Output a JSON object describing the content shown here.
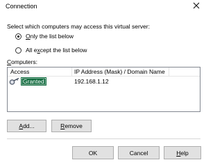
{
  "window": {
    "title": "Connection"
  },
  "prompt": "Select which computers may access this virtual server:",
  "radios": [
    {
      "label": "Only the list below",
      "accel_index": 0,
      "checked": true
    },
    {
      "label": "All except the list below",
      "accel_index": 5,
      "checked": false
    }
  ],
  "computers": {
    "label": "Computers:",
    "columns": [
      "Access",
      "IP Address (Mask) / Domain Name"
    ],
    "rows": [
      {
        "access": "Granted",
        "address": "192.168.1.12",
        "icon": "key-icon",
        "selected": true
      }
    ]
  },
  "buttons": {
    "add": "Add...",
    "remove": "Remove",
    "ok": "OK",
    "cancel": "Cancel",
    "help": "Help"
  },
  "colors": {
    "selected_row_bg": "#0f6b3e",
    "button_face": "#e1e1e1",
    "button_border": "#adadad"
  }
}
